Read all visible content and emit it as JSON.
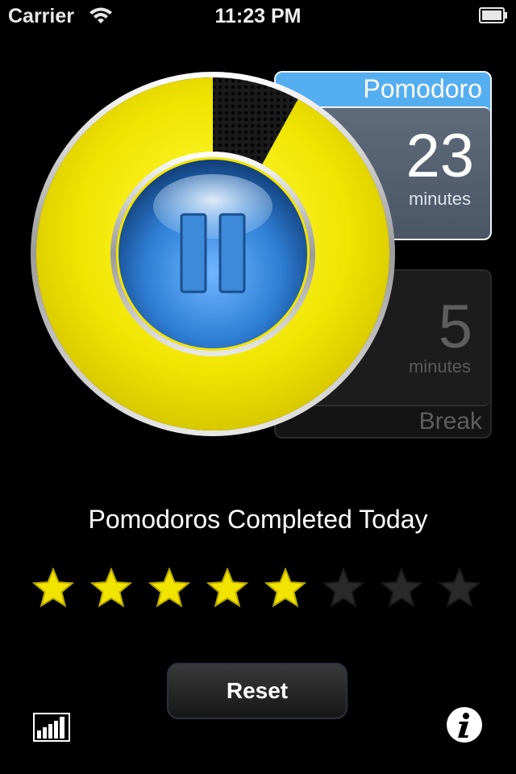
{
  "status_bar": {
    "carrier": "Carrier",
    "time": "11:23 PM",
    "wifi_icon": "wifi-icon",
    "battery_icon": "battery-icon"
  },
  "timer": {
    "pomodoro_label": "Pomodoro",
    "pomodoro_value": "23",
    "pomodoro_unit": "minutes",
    "break_value": "5",
    "break_unit": "minutes",
    "break_label": "Break",
    "remaining_fraction": 0.92,
    "pause_icon": "pause-icon",
    "colors": {
      "ring": "#f0e400",
      "button": "#2f7fd6",
      "pomodoro_accent": "#55aef0"
    }
  },
  "completed": {
    "title": "Pomodoros Completed Today",
    "count": 5,
    "total": 8,
    "star_icon": "star-icon"
  },
  "actions": {
    "reset_label": "Reset",
    "stats_icon": "bar-chart-icon",
    "info_icon": "info-icon"
  }
}
